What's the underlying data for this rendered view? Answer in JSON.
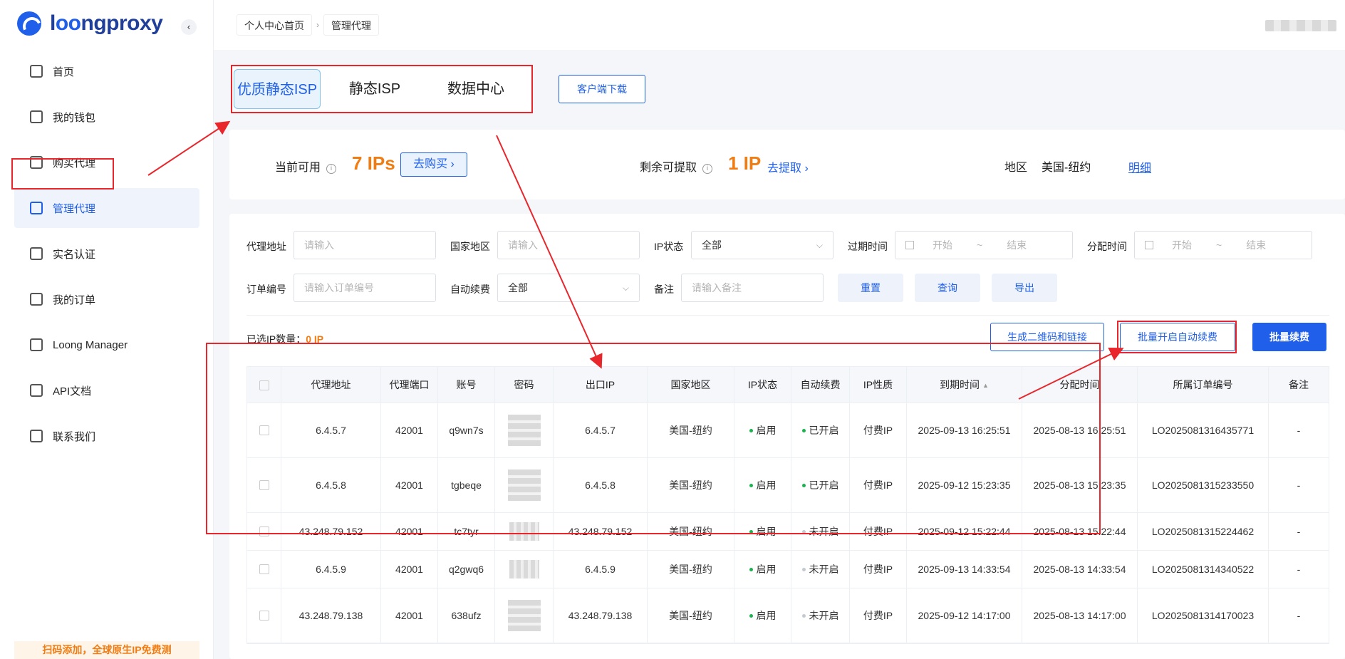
{
  "brand": {
    "name_pre": "l",
    "name_oo": "oo",
    "name_post": "ngproxy"
  },
  "sidebar": {
    "collapse": "‹",
    "items": [
      {
        "label": "首页",
        "icon": "home-icon"
      },
      {
        "label": "我的钱包",
        "icon": "wallet-icon"
      },
      {
        "label": "购买代理",
        "icon": "shopping-bag-icon"
      },
      {
        "label": "管理代理",
        "icon": "folder-icon",
        "active": true
      },
      {
        "label": "实名认证",
        "icon": "id-scan-icon"
      },
      {
        "label": "我的订单",
        "icon": "order-list-icon"
      },
      {
        "label": "Loong Manager",
        "icon": "download-icon"
      },
      {
        "label": "API文档",
        "icon": "code-doc-icon"
      },
      {
        "label": "联系我们",
        "icon": "contact-icon"
      }
    ],
    "promo": "扫码添加，全球原生IP免费测"
  },
  "breadcrumb": [
    "个人中心首页",
    "管理代理"
  ],
  "tabs": [
    "优质静态ISP",
    "静态ISP",
    "数据中心"
  ],
  "download_btn": "客户端下载",
  "summary": {
    "available_label": "当前可用",
    "available_value": "7 IPs",
    "buy_btn": "去购买 ›",
    "remaining_label": "剩余可提取",
    "remaining_value": "1 IP",
    "extract_link": "去提取 ›",
    "region_label": "地区",
    "region_value": "美国-纽约",
    "detail_link": "明细"
  },
  "filters": {
    "proxy_addr": {
      "label": "代理地址",
      "placeholder": "请输入"
    },
    "country": {
      "label": "国家地区",
      "placeholder": "请输入"
    },
    "ip_status": {
      "label": "IP状态",
      "value": "全部"
    },
    "expire_time": {
      "label": "过期时间",
      "start": "开始",
      "sep": "~",
      "end": "结束"
    },
    "assign_time": {
      "label": "分配时间",
      "start": "开始",
      "sep": "~",
      "end": "结束"
    },
    "order_no": {
      "label": "订单编号",
      "placeholder": "请输入订单编号"
    },
    "auto_renew": {
      "label": "自动续费",
      "value": "全部"
    },
    "remark": {
      "label": "备注",
      "placeholder": "请输入备注"
    },
    "reset_btn": "重置",
    "query_btn": "查询",
    "export_btn": "导出"
  },
  "selection": {
    "label": "已选IP数量：",
    "count": "0 IP"
  },
  "actions": {
    "qr_btn": "生成二维码和链接",
    "auto_btn": "批量开启自动续费",
    "batch_btn": "批量续费"
  },
  "table": {
    "headers": [
      "代理地址",
      "代理端口",
      "账号",
      "密码",
      "出口IP",
      "国家地区",
      "IP状态",
      "自动续费",
      "IP性质",
      "到期时间",
      "分配时间",
      "所属订单编号",
      "备注"
    ],
    "rows": [
      {
        "addr": "6.4.5.7",
        "port": "42001",
        "account": "q9wn7s",
        "exit_ip": "6.4.5.7",
        "region": "美国-纽约",
        "status": "启用",
        "auto": "已开启",
        "auto_on": true,
        "type": "付费IP",
        "expire": "2025-09-13 16:25:51",
        "assign": "2025-08-13 16:25:51",
        "order": "LO2025081316435771",
        "remark": "-"
      },
      {
        "addr": "6.4.5.8",
        "port": "42001",
        "account": "tgbeqe",
        "exit_ip": "6.4.5.8",
        "region": "美国-纽约",
        "status": "启用",
        "auto": "已开启",
        "auto_on": true,
        "type": "付费IP",
        "expire": "2025-09-12 15:23:35",
        "assign": "2025-08-13 15:23:35",
        "order": "LO2025081315233550",
        "remark": "-"
      },
      {
        "addr": "43.248.79.152",
        "port": "42001",
        "account": "tc7tyr",
        "exit_ip": "43.248.79.152",
        "region": "美国-纽约",
        "status": "启用",
        "auto": "未开启",
        "auto_on": false,
        "type": "付费IP",
        "expire": "2025-09-12 15:22:44",
        "assign": "2025-08-13 15:22:44",
        "order": "LO2025081315224462",
        "remark": "-"
      },
      {
        "addr": "6.4.5.9",
        "port": "42001",
        "account": "q2gwq6",
        "exit_ip": "6.4.5.9",
        "region": "美国-纽约",
        "status": "启用",
        "auto": "未开启",
        "auto_on": false,
        "type": "付费IP",
        "expire": "2025-09-13 14:33:54",
        "assign": "2025-08-13 14:33:54",
        "order": "LO2025081314340522",
        "remark": "-"
      },
      {
        "addr": "43.248.79.138",
        "port": "42001",
        "account": "638ufz",
        "exit_ip": "43.248.79.138",
        "region": "美国-纽约",
        "status": "启用",
        "auto": "未开启",
        "auto_on": false,
        "type": "付费IP",
        "expire": "2025-09-12 14:17:00",
        "assign": "2025-08-13 14:17:00",
        "order": "LO2025081314170023",
        "remark": "-"
      }
    ]
  },
  "colors": {
    "accent": "#1f5fea",
    "highlight": "#f07d13",
    "annotation": "#e8262b",
    "enabled": "#1ab34d"
  }
}
